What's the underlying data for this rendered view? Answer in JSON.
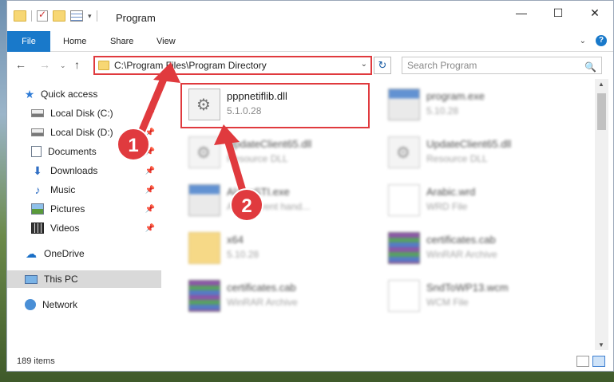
{
  "window": {
    "title": "Program",
    "minimize": "—",
    "maximize": "☐",
    "close": "✕"
  },
  "ribbon": {
    "tabs": [
      {
        "label": "File"
      },
      {
        "label": "Home"
      },
      {
        "label": "Share"
      },
      {
        "label": "View"
      }
    ],
    "expand_glyph": "⌄",
    "help_glyph": "?"
  },
  "nav_glyphs": {
    "back": "←",
    "forward": "→",
    "recent": "⌄",
    "up": "↑"
  },
  "address": {
    "path": "C:\\Program Files\\Program Directory",
    "dropdown_glyph": "⌄",
    "refresh_glyph": "↻"
  },
  "search": {
    "placeholder": "Search Program",
    "icon_glyph": "🔍"
  },
  "sidebar": {
    "items": [
      {
        "label": "Quick access",
        "pinned": false
      },
      {
        "label": "Local Disk (C:)",
        "pinned": true
      },
      {
        "label": "Local Disk (D:)",
        "pinned": true
      },
      {
        "label": "Documents",
        "pinned": true
      },
      {
        "label": "Downloads",
        "pinned": true
      },
      {
        "label": "Music",
        "pinned": true
      },
      {
        "label": "Pictures",
        "pinned": true
      },
      {
        "label": "Videos",
        "pinned": true
      },
      {
        "label": "OneDrive",
        "pinned": false
      },
      {
        "label": "This PC",
        "pinned": false,
        "selected": true
      },
      {
        "label": "Network",
        "pinned": false
      }
    ],
    "pin_glyph": "📌",
    "star_glyph": "★",
    "download_glyph": "⬇",
    "music_glyph": "♪",
    "cloud_glyph": "☁"
  },
  "files": [
    {
      "name": "pppnetiflib.dll",
      "sub": "5.1.0.28",
      "icon": "dll-gear-icon",
      "blurred": false
    },
    {
      "name": "program.exe",
      "sub": "5.10.28",
      "icon": "exe-icon",
      "blurred": true
    },
    {
      "name": "UpdateClient65.dll",
      "sub": "Resource DLL",
      "icon": "dll-gear-icon",
      "blurred": true
    },
    {
      "name": "UpdateClient65.dll",
      "sub": "Resource DLL",
      "icon": "dll-gear-icon",
      "blurred": true
    },
    {
      "name": "AlarmSTI.exe",
      "sub": "Alarm event hand...",
      "icon": "exe-icon",
      "blurred": true
    },
    {
      "name": "Arabic.wrd",
      "sub": "WRD File",
      "icon": "document-icon",
      "blurred": true
    },
    {
      "name": "x64",
      "sub": "5.10.28",
      "icon": "folder-icon",
      "blurred": true
    },
    {
      "name": "certificates.cab",
      "sub": "WinRAR Archive",
      "icon": "winrar-icon",
      "blurred": true
    },
    {
      "name": "certificates.cab",
      "sub": "WinRAR Archive",
      "icon": "winrar-icon",
      "blurred": true
    },
    {
      "name": "SndToWP13.wcm",
      "sub": "WCM File",
      "icon": "document-icon",
      "blurred": true
    }
  ],
  "status": {
    "item_count": "189 items"
  },
  "annotations": [
    {
      "number": "1",
      "color": "#e03a3e"
    },
    {
      "number": "2",
      "color": "#e03a3e"
    }
  ],
  "colors": {
    "accent": "#1979ca",
    "highlight": "#e03a3e"
  }
}
